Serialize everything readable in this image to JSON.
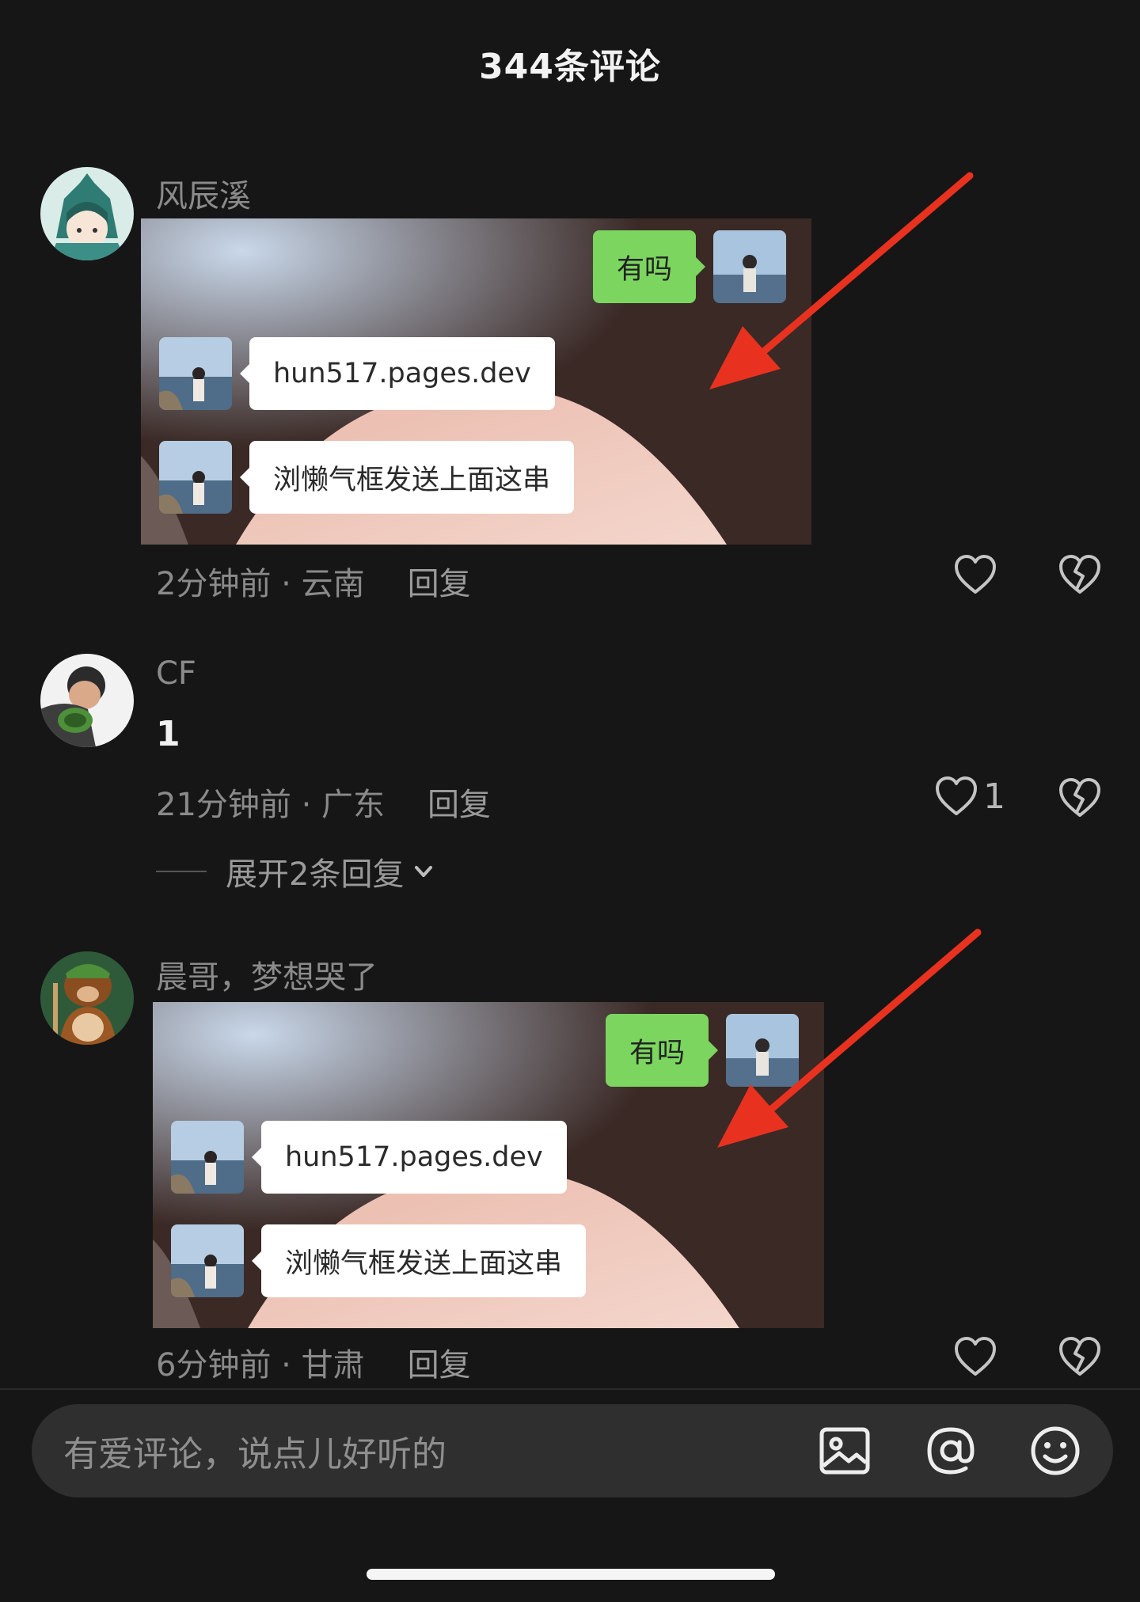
{
  "header": {
    "title": "344条评论"
  },
  "shot_texts": {
    "question": "有吗",
    "link": "hun517.pages.dev",
    "instruction": "浏懒气框发送上面这串"
  },
  "comments": [
    {
      "username": "风辰溪",
      "time_location": "2分钟前 · 云南",
      "reply": "回复",
      "like_count": ""
    },
    {
      "username": "CF",
      "text": "1",
      "time_location": "21分钟前 · 广东",
      "reply": "回复",
      "like_count": "1",
      "expand": "展开2条回复"
    },
    {
      "username": "晨哥，梦想哭了",
      "time_location": "6分钟前 · 甘肃",
      "reply": "回复",
      "like_count": ""
    }
  ],
  "input": {
    "placeholder": "有爱评论，说点儿好听的"
  },
  "colors": {
    "background": "#161616",
    "bubble_green": "#7bd55f",
    "arrow": "#e8321f"
  }
}
